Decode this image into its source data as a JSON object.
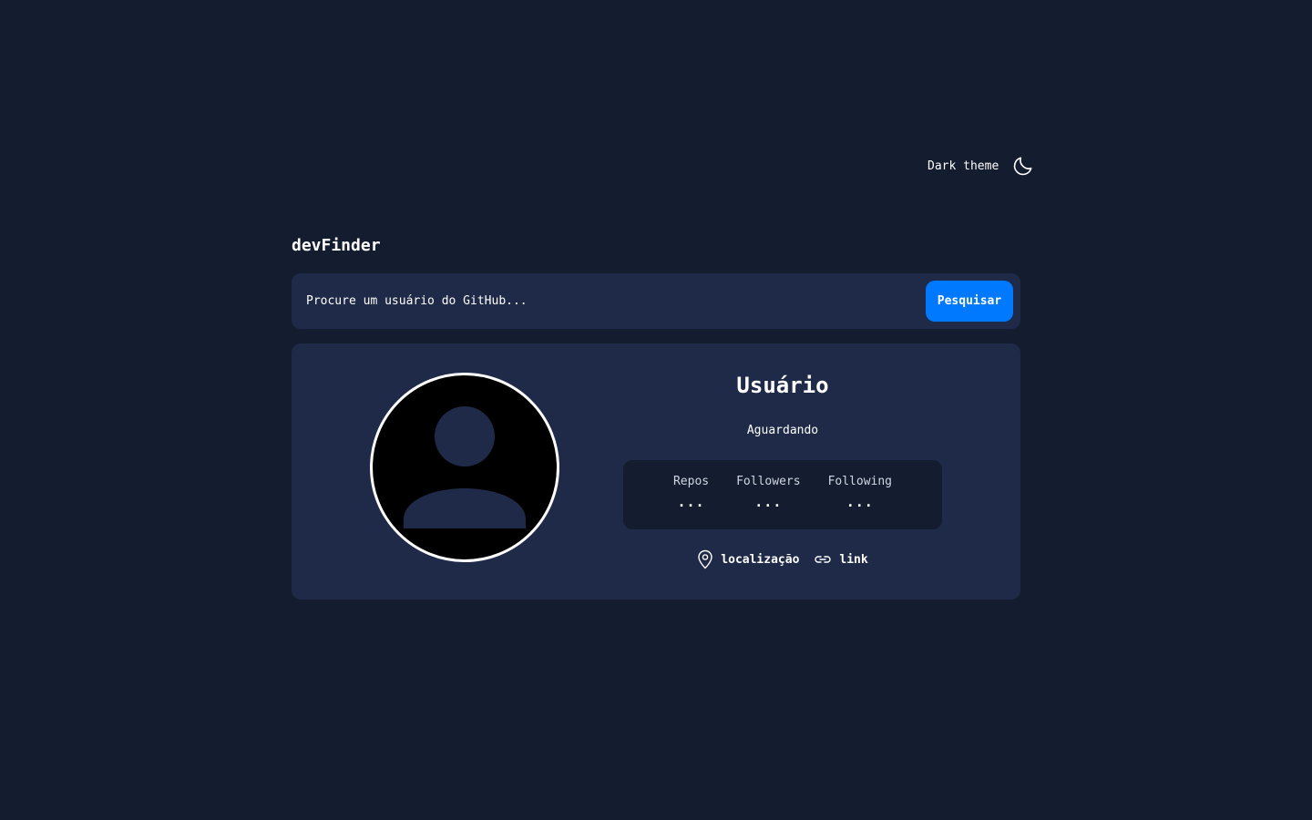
{
  "header": {
    "theme_label": "Dark theme",
    "theme_icon": "moon-icon"
  },
  "app": {
    "logo": "devFinder"
  },
  "search": {
    "placeholder": "Procure um usuário do GitHub...",
    "button_label": "Pesquisar",
    "button_color": "#0079ff"
  },
  "profile": {
    "avatar_icon": "user-placeholder-icon",
    "name": "Usuário",
    "bio": "Aguardando",
    "stats": [
      {
        "label": "Repos",
        "value": "..."
      },
      {
        "label": "Followers",
        "value": "..."
      },
      {
        "label": "Following",
        "value": "..."
      }
    ],
    "location": {
      "icon": "location-pin-icon",
      "text": "localização"
    },
    "link": {
      "icon": "link-icon",
      "text": "link"
    }
  },
  "colors": {
    "background": "#141c2f",
    "card": "#1f2a48",
    "accent": "#0079ff"
  }
}
